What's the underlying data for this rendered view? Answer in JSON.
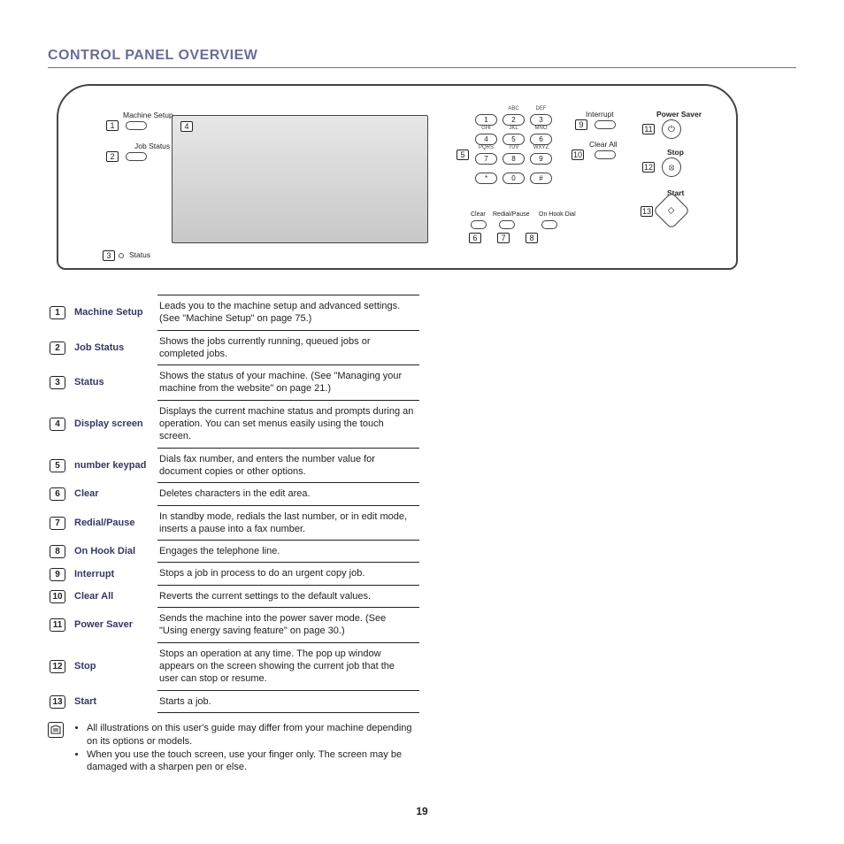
{
  "heading": "CONTROL PANEL OVERVIEW",
  "page_number": "19",
  "panel_labels": {
    "machine_setup": "Machine Setup",
    "job_status": "Job Status",
    "status": "Status",
    "interrupt": "Interrupt",
    "clear_all": "Clear All",
    "power_saver": "Power Saver",
    "stop": "Stop",
    "start": "Start",
    "clear": "Clear",
    "redial_pause": "Redial/Pause",
    "on_hook_dial": "On Hook Dial"
  },
  "keypad": {
    "keys": [
      "1",
      "2",
      "3",
      "4",
      "5",
      "6",
      "7",
      "8",
      "9",
      "*",
      "0",
      "#"
    ],
    "subs": [
      "",
      "ABC",
      "DEF",
      "GHI",
      "JKL",
      "MNO",
      "PQRS",
      "TUV",
      "WXYZ",
      "",
      "",
      ""
    ]
  },
  "table": [
    {
      "n": "1",
      "name": "Machine Setup",
      "desc": "Leads you to the machine setup and advanced settings. (See \"Machine Setup\" on page 75.)"
    },
    {
      "n": "2",
      "name": "Job Status",
      "desc": "Shows the jobs currently running, queued jobs or completed jobs."
    },
    {
      "n": "3",
      "name": "Status",
      "desc": "Shows the status of your machine. (See \"Managing your machine from the website\" on page 21.)"
    },
    {
      "n": "4",
      "name": "Display screen",
      "desc": "Displays the current machine status and prompts during an operation. You can set menus easily using the touch screen."
    },
    {
      "n": "5",
      "name": "number keypad",
      "desc": "Dials fax number, and enters the number value for document copies or other options."
    },
    {
      "n": "6",
      "name": "Clear",
      "desc": "Deletes characters in the edit area."
    },
    {
      "n": "7",
      "name": "Redial/Pause",
      "desc": "In standby mode, redials the last number, or in edit mode, inserts a pause into a fax number."
    },
    {
      "n": "8",
      "name": "On Hook Dial",
      "desc": "Engages the telephone line."
    },
    {
      "n": "9",
      "name": "Interrupt",
      "desc": "Stops a job in process to do an urgent copy job."
    },
    {
      "n": "10",
      "name": "Clear All",
      "desc": "Reverts the current settings to the default values."
    },
    {
      "n": "11",
      "name": "Power Saver",
      "desc": "Sends the machine into the power saver mode. (See \"Using energy saving feature\" on page 30.)"
    },
    {
      "n": "12",
      "name": "Stop",
      "desc": "Stops an operation at any time. The pop up window appears on the screen showing the current job that the user can stop or resume."
    },
    {
      "n": "13",
      "name": "Start",
      "desc": "Starts a job."
    }
  ],
  "notes": [
    "All illustrations on this user's guide may differ from your machine depending on its options or models.",
    "When you use the touch screen, use your finger only. The screen may be damaged with a sharpen pen or else."
  ]
}
